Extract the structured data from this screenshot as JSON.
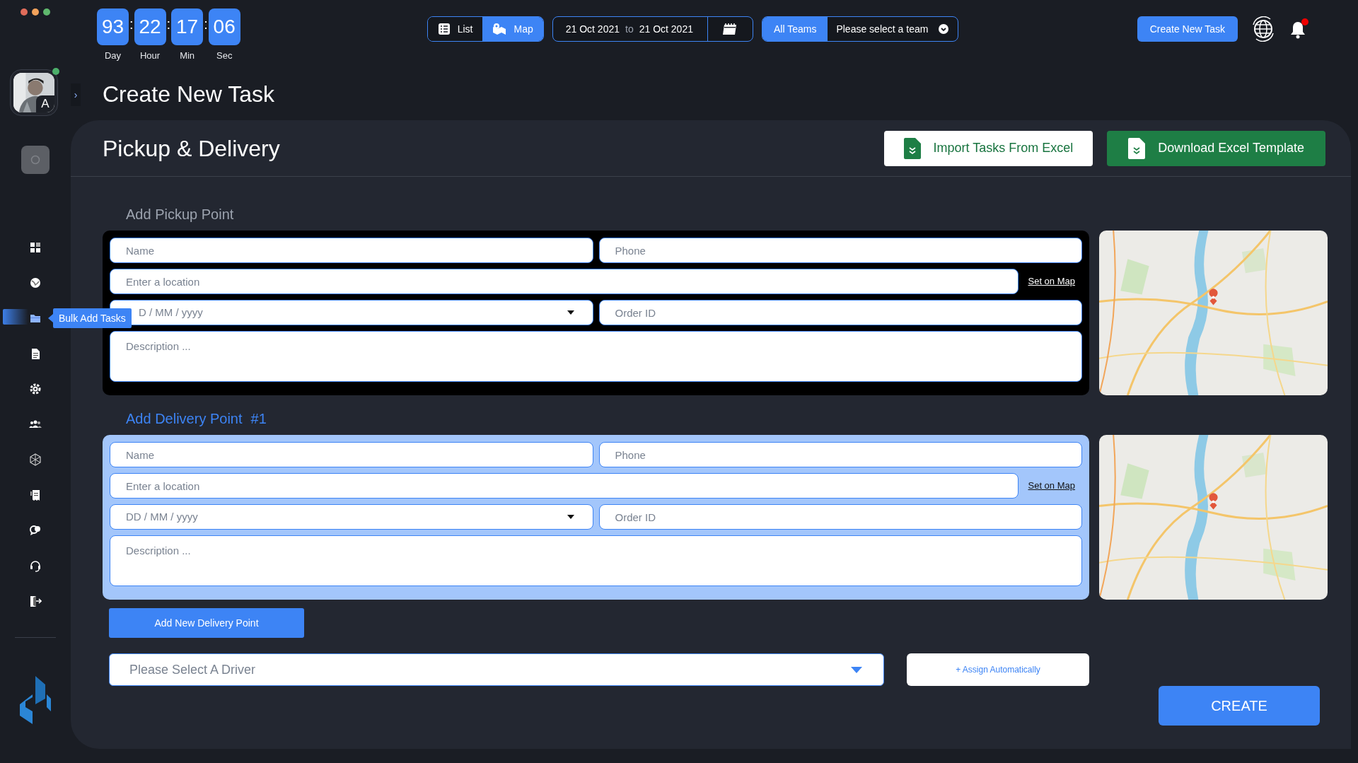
{
  "timer": {
    "separator": ":",
    "units": [
      {
        "value": "93",
        "label": "Day"
      },
      {
        "value": "22",
        "label": "Hour"
      },
      {
        "value": "17",
        "label": "Min"
      },
      {
        "value": "06",
        "label": "Sec"
      }
    ]
  },
  "expand_button": "›",
  "view_toggle": [
    {
      "label": "List",
      "selected": false
    },
    {
      "label": "Map",
      "selected": true
    }
  ],
  "date_range": {
    "from": "21 Oct 2021",
    "separator": "to",
    "to": "21 Oct 2021"
  },
  "teams": {
    "label": "All Teams",
    "placeholder": "Please select a team"
  },
  "create_task_button": "Create New Task",
  "notifications": {
    "unread": true
  },
  "user": {
    "initial": "A",
    "online": true
  },
  "sidebar": {
    "items": [
      {
        "selected": false
      },
      {
        "selected": false
      },
      {
        "selected": true,
        "tooltip": "Bulk Add Tasks"
      },
      {
        "selected": false
      },
      {
        "selected": false
      },
      {
        "selected": false
      },
      {
        "selected": false
      },
      {
        "selected": false
      },
      {
        "selected": false
      },
      {
        "selected": false
      },
      {
        "selected": false
      }
    ]
  },
  "page_title": "Create New Task",
  "card": {
    "title": "Pickup & Delivery",
    "import_button": "Import Tasks From Excel",
    "template_button": "Download Excel Template"
  },
  "points": [
    {
      "title": "Add Pickup Point",
      "active": false,
      "fields": {
        "name": {
          "placeholder": "Name"
        },
        "phone": {
          "placeholder": "Phone"
        },
        "location": {
          "placeholder": "Enter a location"
        },
        "set_on_map": "Set on Map",
        "date": {
          "placeholder": "D / MM / yyyy"
        },
        "order_id": {
          "placeholder": "Order ID"
        },
        "description": {
          "placeholder": "Description ..."
        }
      }
    },
    {
      "title": "Add Delivery Point",
      "number": "#1",
      "active": true,
      "fields": {
        "name": {
          "placeholder": "Name"
        },
        "phone": {
          "placeholder": "Phone"
        },
        "location": {
          "placeholder": "Enter a location"
        },
        "set_on_map": "Set on Map",
        "date": {
          "placeholder": "DD / MM / yyyy"
        },
        "order_id": {
          "placeholder": "Order ID"
        },
        "description": {
          "placeholder": "Description ..."
        }
      }
    }
  ],
  "add_delivery_button": "Add New Delivery Point",
  "driver": {
    "placeholder": "Please Select A Driver"
  },
  "assign_button": "+ Assign Automatically",
  "create_button": "CREATE"
}
